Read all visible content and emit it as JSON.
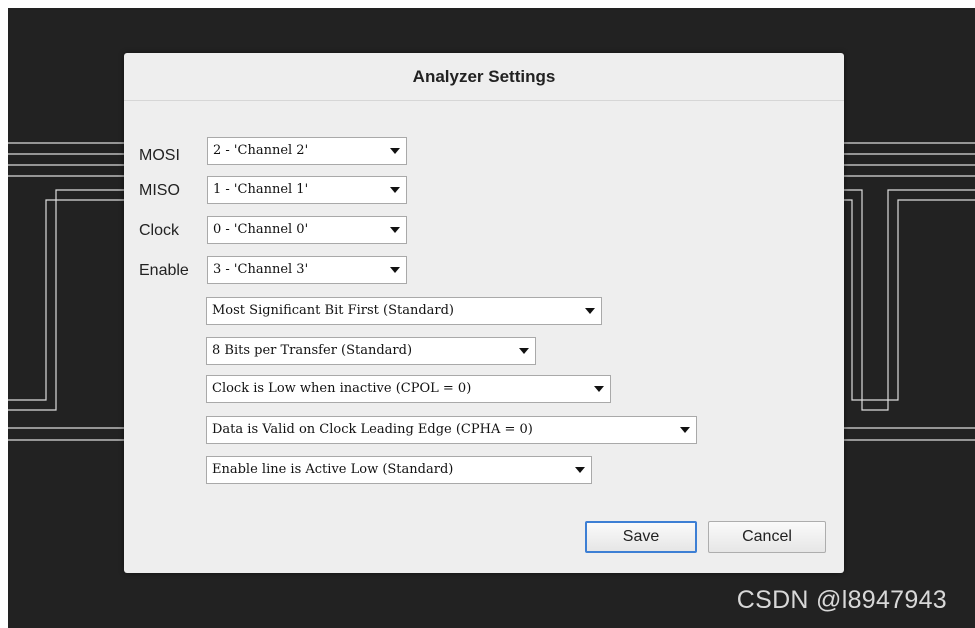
{
  "dialog": {
    "title": "Analyzer Settings",
    "fields": {
      "mosi": {
        "label": "MOSI",
        "value": "2 - 'Channel 2'"
      },
      "miso": {
        "label": "MISO",
        "value": "1 - 'Channel 1'"
      },
      "clock": {
        "label": "Clock",
        "value": "0 - 'Channel 0'"
      },
      "enable": {
        "label": "Enable",
        "value": "3 - 'Channel 3'"
      }
    },
    "options": {
      "bit_order": "Most Significant Bit First (Standard)",
      "bits_per_transfer": "8 Bits per Transfer (Standard)",
      "clock_polarity": "Clock is Low when inactive (CPOL = 0)",
      "clock_phase": "Data is Valid on Clock Leading Edge (CPHA = 0)",
      "enable_polarity": "Enable line is Active Low (Standard)"
    },
    "buttons": {
      "save": "Save",
      "cancel": "Cancel"
    }
  },
  "watermark": "CSDN @l8947943",
  "colors": {
    "app_background": "#222222",
    "dialog_background": "#eeeeee",
    "waveform_line": "#dcdcdc",
    "save_focus_border": "#3d7fd4"
  }
}
